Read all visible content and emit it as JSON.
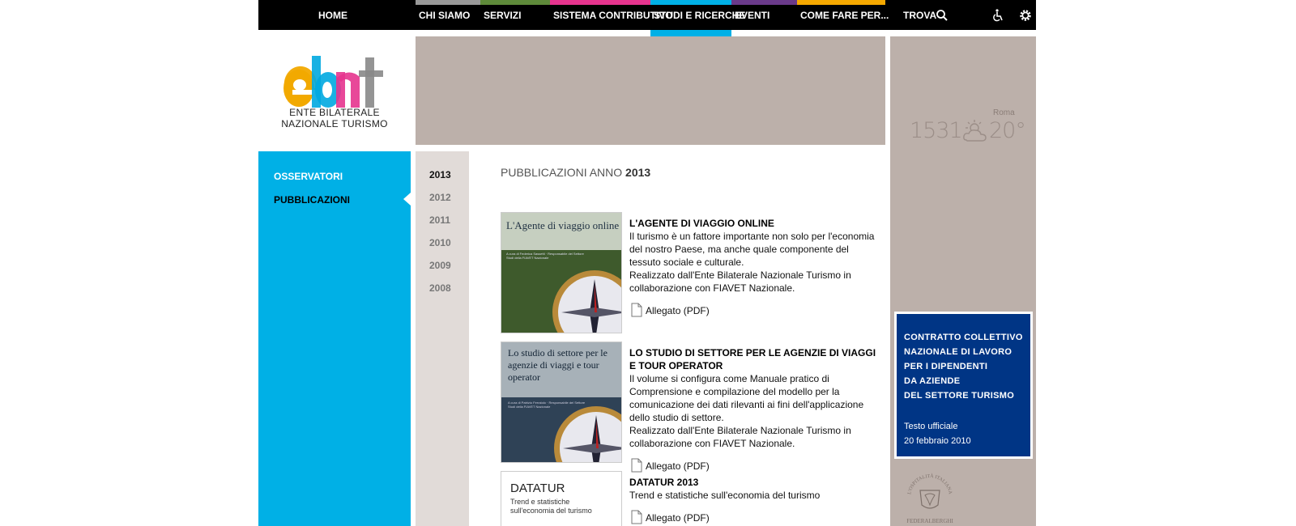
{
  "nav": {
    "items": [
      {
        "label": "HOME",
        "color": "#000000"
      },
      {
        "label": "CHI SIAMO",
        "color": "#999999"
      },
      {
        "label": "SERVIZI",
        "color": "#5e8a3a"
      },
      {
        "label": "SISTEMA CONTRIBUTIVO",
        "color": "#e6348e"
      },
      {
        "label": "STUDI E RICERCHE",
        "color": "#00b0e6"
      },
      {
        "label": "EVENTI",
        "color": "#6a3a8a"
      },
      {
        "label": "COME FARE PER...",
        "color": "#f5a800"
      },
      {
        "label": "TROVA",
        "color": "#000000"
      }
    ],
    "icons": [
      "search-icon",
      "accessibility-icon",
      "settings-icon"
    ]
  },
  "logo": {
    "letters": "ebnt",
    "line1": "ENTE BILATERALE",
    "line2": "NAZIONALE TURISMO",
    "colors": [
      "#f2a900",
      "#00a8e0",
      "#e6348e",
      "#888888"
    ]
  },
  "sidebar": {
    "items": [
      {
        "label": "OSSERVATORI",
        "color": "#ffffff"
      },
      {
        "label": "PUBBLICAZIONI",
        "color": "#000000"
      }
    ]
  },
  "years": [
    "2013",
    "2012",
    "2011",
    "2010",
    "2009",
    "2008"
  ],
  "main": {
    "title_prefix": "PUBBLICAZIONI ANNO",
    "title_year": "2013",
    "attach_label": "Allegato (PDF)",
    "publications": [
      {
        "title": "L'AGENTE DI VIAGGIO ONLINE",
        "desc1": "Il turismo è un fattore importante non solo per l'economia del nostro Paese, ma anche quale componente del tessuto sociale e culturale.",
        "desc2": "Realizzato dall'Ente Bilaterale Nazionale Turismo in collaborazione con FIAVET Nazionale.",
        "cover_title": "L'Agente di viaggio online",
        "cover_sub": "A cura di Federica Sassetti · Responsabile del Settore Studi della FIAVET Nazionale"
      },
      {
        "title": "LO STUDIO DI SETTORE PER LE AGENZIE DI VIAGGI E TOUR OPERATOR",
        "desc1": "Il volume si configura come Manuale pratico di Comprensione e compilazione del modello per la comunicazione dei dati rilevanti ai fini dell'applicazione dello studio di settore.",
        "desc2": "Realizzato dall'Ente Bilaterale Nazionale Turismo in collaborazione con FIAVET Nazionale.",
        "cover_title": "Lo studio di settore per le agenzie di viaggi e tour operator",
        "cover_sub": "A cura di Patrizio Ferraiolo · Responsabile del Settore Studi della FIAVET Nazionale"
      },
      {
        "title": "DATATUR 2013",
        "desc1": "Trend e statistiche sull'economia del turismo",
        "desc2": "",
        "cover_title": "DATATUR",
        "cover_sub": "Trend e statistiche sull'economia del turismo"
      }
    ]
  },
  "weather": {
    "city": "Roma",
    "time": "1531",
    "temp": "20°"
  },
  "contract": {
    "line1": "CONTRATTO COLLETTIVO",
    "line2": "NAZIONALE DI LAVORO",
    "line3": "PER I DIPENDENTI",
    "line4": "DA AZIENDE",
    "line5": "DEL SETTORE TURISMO",
    "sub1": "Testo ufficiale",
    "sub2": "20 febbraio 2010"
  },
  "seal": {
    "top": "L'OSPITALITÀ ITALIANA",
    "bottom": "FEDERALBERGHI"
  }
}
